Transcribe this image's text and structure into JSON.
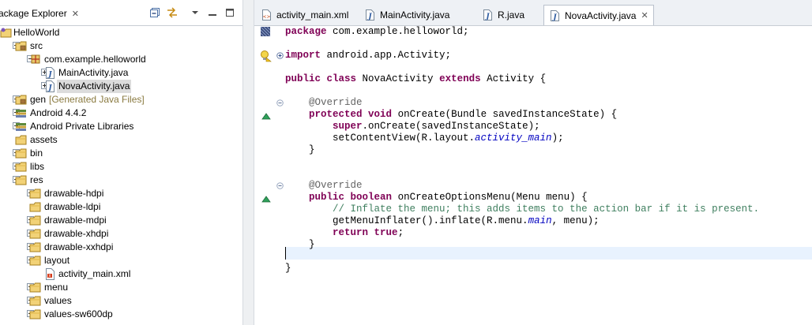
{
  "explorer": {
    "title": "ackage Explorer",
    "tree": [
      {
        "label": "HelloWorld",
        "icon": "project-icon",
        "name": "project-helloworld"
      },
      {
        "label": "src",
        "icon": "source-folder-icon",
        "name": "folder-src"
      },
      {
        "label": "com.example.helloworld",
        "icon": "package-icon",
        "name": "package-com-example-helloworld"
      },
      {
        "label": "MainActivity.java",
        "icon": "java-file-icon",
        "name": "file-mainactivity-java"
      },
      {
        "label": "NovaActivity.java",
        "icon": "java-file-icon",
        "name": "file-novaactivity-java"
      },
      {
        "label": "gen",
        "decoration": "[Generated Java Files]",
        "icon": "source-folder-icon",
        "name": "folder-gen"
      },
      {
        "label": "Android 4.4.2",
        "icon": "library-icon",
        "name": "library-android-4-4-2"
      },
      {
        "label": "Android Private Libraries",
        "icon": "library-icon",
        "name": "library-android-private"
      },
      {
        "label": "assets",
        "icon": "folder-icon",
        "name": "folder-assets"
      },
      {
        "label": "bin",
        "icon": "folder-icon",
        "name": "folder-bin"
      },
      {
        "label": "libs",
        "icon": "folder-icon",
        "name": "folder-libs"
      },
      {
        "label": "res",
        "icon": "folder-icon",
        "name": "folder-res"
      },
      {
        "label": "drawable-hdpi",
        "icon": "folder-icon",
        "name": "folder-drawable-hdpi"
      },
      {
        "label": "drawable-ldpi",
        "icon": "folder-icon",
        "name": "folder-drawable-ldpi"
      },
      {
        "label": "drawable-mdpi",
        "icon": "folder-icon",
        "name": "folder-drawable-mdpi"
      },
      {
        "label": "drawable-xhdpi",
        "icon": "folder-icon",
        "name": "folder-drawable-xhdpi"
      },
      {
        "label": "drawable-xxhdpi",
        "icon": "folder-icon",
        "name": "folder-drawable-xxhdpi"
      },
      {
        "label": "layout",
        "icon": "folder-icon",
        "name": "folder-layout"
      },
      {
        "label": "activity_main.xml",
        "icon": "xml-file-icon",
        "name": "file-activity-main-xml"
      },
      {
        "label": "menu",
        "icon": "folder-icon",
        "name": "folder-menu"
      },
      {
        "label": "values",
        "icon": "folder-icon",
        "name": "folder-values"
      },
      {
        "label": "values-sw600dp",
        "icon": "folder-icon",
        "name": "folder-values-sw600dp"
      }
    ]
  },
  "editor": {
    "tabs": [
      {
        "label": "activity_main.xml",
        "icon": "xml-file-icon",
        "name": "tab-activity-main-xml"
      },
      {
        "label": "MainActivity.java",
        "icon": "java-file-icon",
        "name": "tab-mainactivity-java"
      },
      {
        "label": "R.java",
        "icon": "java-file-icon",
        "name": "tab-r-java"
      },
      {
        "label": "NovaActivity.java",
        "icon": "java-file-icon",
        "name": "tab-novaactivity-java",
        "active": true
      }
    ],
    "code": {
      "package": "package",
      "package_name": " com.example.helloworld;",
      "import": "import",
      "import_name": " android.app.Activity;",
      "public": "public",
      "class": "class",
      "class_name": " NovaActivity ",
      "extends": "extends",
      "super_name": " Activity {",
      "override": "@Override",
      "protected": "protected",
      "void": "void",
      "oncreate_sig": " onCreate(Bundle savedInstanceState) {",
      "super_kw": "super",
      "super_call": ".onCreate(savedInstanceState);",
      "setcontent_prefix": "setContentView(R.layout.",
      "activity_main": "activity_main",
      "call_suffix": ");",
      "close_brace": "}",
      "boolean": "boolean",
      "menu_sig": " onCreateOptionsMenu(Menu menu) {",
      "comment": "// Inflate the menu; this adds items to the action bar if it is present.",
      "inflate_prefix": "getMenuInflater().inflate(R.menu.",
      "main": "main",
      "inflate_suffix": ", menu);",
      "return": "return",
      "true": "true",
      "semicolon": ";"
    }
  }
}
